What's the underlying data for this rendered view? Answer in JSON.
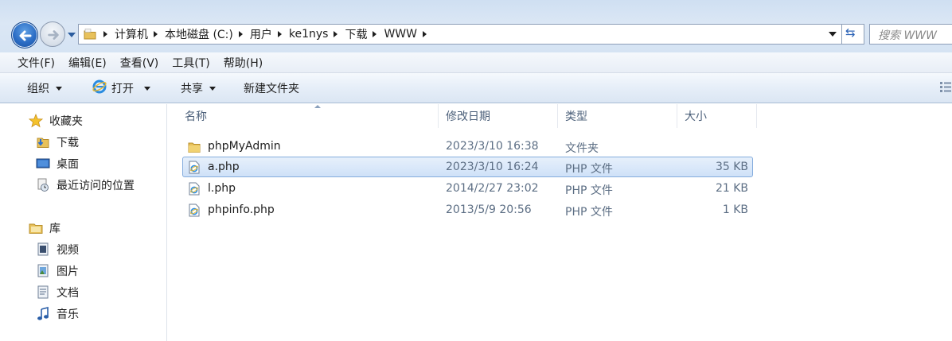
{
  "address_bar": {
    "breadcrumbs": [
      "计算机",
      "本地磁盘 (C:)",
      "用户",
      "ke1nys",
      "下载",
      "WWW"
    ],
    "search_placeholder": "搜索 WWW"
  },
  "menu": [
    "文件(F)",
    "编辑(E)",
    "查看(V)",
    "工具(T)",
    "帮助(H)"
  ],
  "toolbar": {
    "organize": "组织",
    "open": "打开",
    "share": "共享",
    "new_folder": "新建文件夹"
  },
  "nav_pane": {
    "favorites_label": "收藏夹",
    "favorites": [
      "下载",
      "桌面",
      "最近访问的位置"
    ],
    "libraries_label": "库",
    "libraries": [
      "视频",
      "图片",
      "文档",
      "音乐"
    ]
  },
  "columns": {
    "name": "名称",
    "modified": "修改日期",
    "type": "类型",
    "size": "大小"
  },
  "files": [
    {
      "name": "phpMyAdmin",
      "modified": "2023/3/10 16:38",
      "type": "文件夹",
      "size": "",
      "icon": "folder-icon"
    },
    {
      "name": "a.php",
      "modified": "2023/3/10 16:24",
      "type": "PHP 文件",
      "size": "35 KB",
      "icon": "php-file-icon",
      "selected": true
    },
    {
      "name": "l.php",
      "modified": "2014/2/27 23:02",
      "type": "PHP 文件",
      "size": "21 KB",
      "icon": "php-file-icon"
    },
    {
      "name": "phpinfo.php",
      "modified": "2013/5/9 20:56",
      "type": "PHP 文件",
      "size": "1 KB",
      "icon": "php-file-icon"
    }
  ],
  "colors": {
    "selection_fill": "#cfe1f8",
    "selection_border": "#84acdd",
    "header_text": "#4c607a",
    "detail_text": "#5c6e84"
  }
}
